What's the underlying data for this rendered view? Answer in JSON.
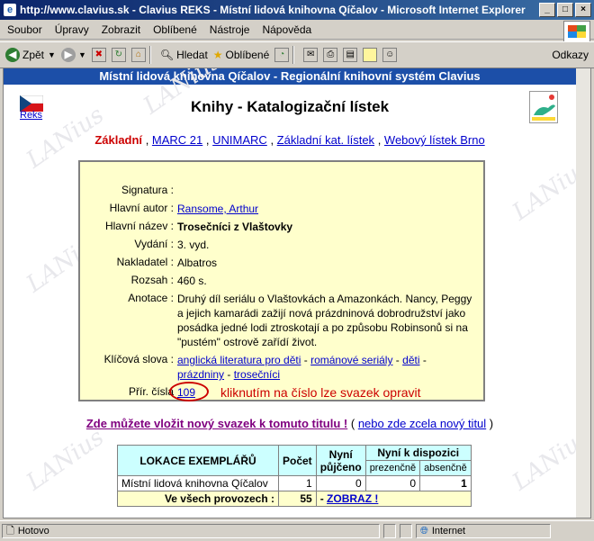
{
  "window": {
    "title": "http://www.clavius.sk - Clavius REKS - Místní lidová knihovna Qíčalov - Microsoft Internet Explorer",
    "controls": [
      "_",
      "□",
      "×"
    ]
  },
  "menu": [
    "Soubor",
    "Úpravy",
    "Zobrazit",
    "Oblíbené",
    "Nástroje",
    "Nápověda"
  ],
  "toolbar": {
    "back": "Zpět",
    "search": "Hledat",
    "favorites": "Oblíbené",
    "links": "Odkazy"
  },
  "page": {
    "banner": "Místní lidová knihovna Qíčalov - Regionální knihovní systém Clavius",
    "reks": "Reks",
    "heading": "Knihy - Katalogizační lístek",
    "watermark": "LANius",
    "tabs": {
      "current": "Základní",
      "links": [
        "MARC 21",
        "UNIMARC",
        "Základní kat. lístek",
        "Webový lístek Brno"
      ]
    },
    "record": {
      "signatura_label": "Signatura :",
      "signatura": "",
      "autor_label": "Hlavní autor :",
      "autor": "Ransome, Arthur",
      "nazev_label": "Hlavní název :",
      "nazev": "Trosečníci z Vlaštovky",
      "vydani_label": "Vydání :",
      "vydani": "3. vyd.",
      "nakladatel_label": "Nakladatel :",
      "nakladatel": "Albatros",
      "rozsah_label": "Rozsah :",
      "rozsah": "460 s.",
      "anotace_label": "Anotace :",
      "anotace": "Druhý díl seriálu o Vlaštovkách a Amazonkách. Nancy, Peggy a jejich kamarádi zažijí nová prázdninová dobrodružství jako posádka jedné lodi ztroskotají a po způsobu Robinsonů si na \"pustém\" ostrově zařídí život.",
      "klicova_label": "Klíčová slova :",
      "klicova": [
        "anglická literatura pro děti",
        "románové seriály",
        "děti",
        "prázdniny",
        "trosečníci"
      ],
      "cisla_label": "Přír. čísla",
      "cislo": "109",
      "hint": "kliknutím na číslo lze svazek opravit"
    },
    "add_volume": "Zde můžete vložit nový svazek k tomuto titulu !",
    "add_new": "nebo zde zcela nový titul",
    "table": {
      "h_lokace": "LOKACE EXEMPLÁŘŮ",
      "h_pocet": "Počet",
      "h_pujceno": "Nyní půjčeno",
      "h_dispozici": "Nyní k dispozici",
      "h_prezencne": "prezenčně",
      "h_absencne": "absenčně",
      "row_name": "Místní lidová knihovna Qíčalov",
      "row_pocet": "1",
      "row_pujceno": "0",
      "row_prezencne": "0",
      "row_absencne": "1",
      "total_label": "Ve všech provozech :",
      "total": "55",
      "zobraz_prefix": "- ",
      "zobraz": "ZOBRAZ !"
    }
  },
  "status": {
    "left": "Hotovo",
    "zone": "Internet"
  }
}
